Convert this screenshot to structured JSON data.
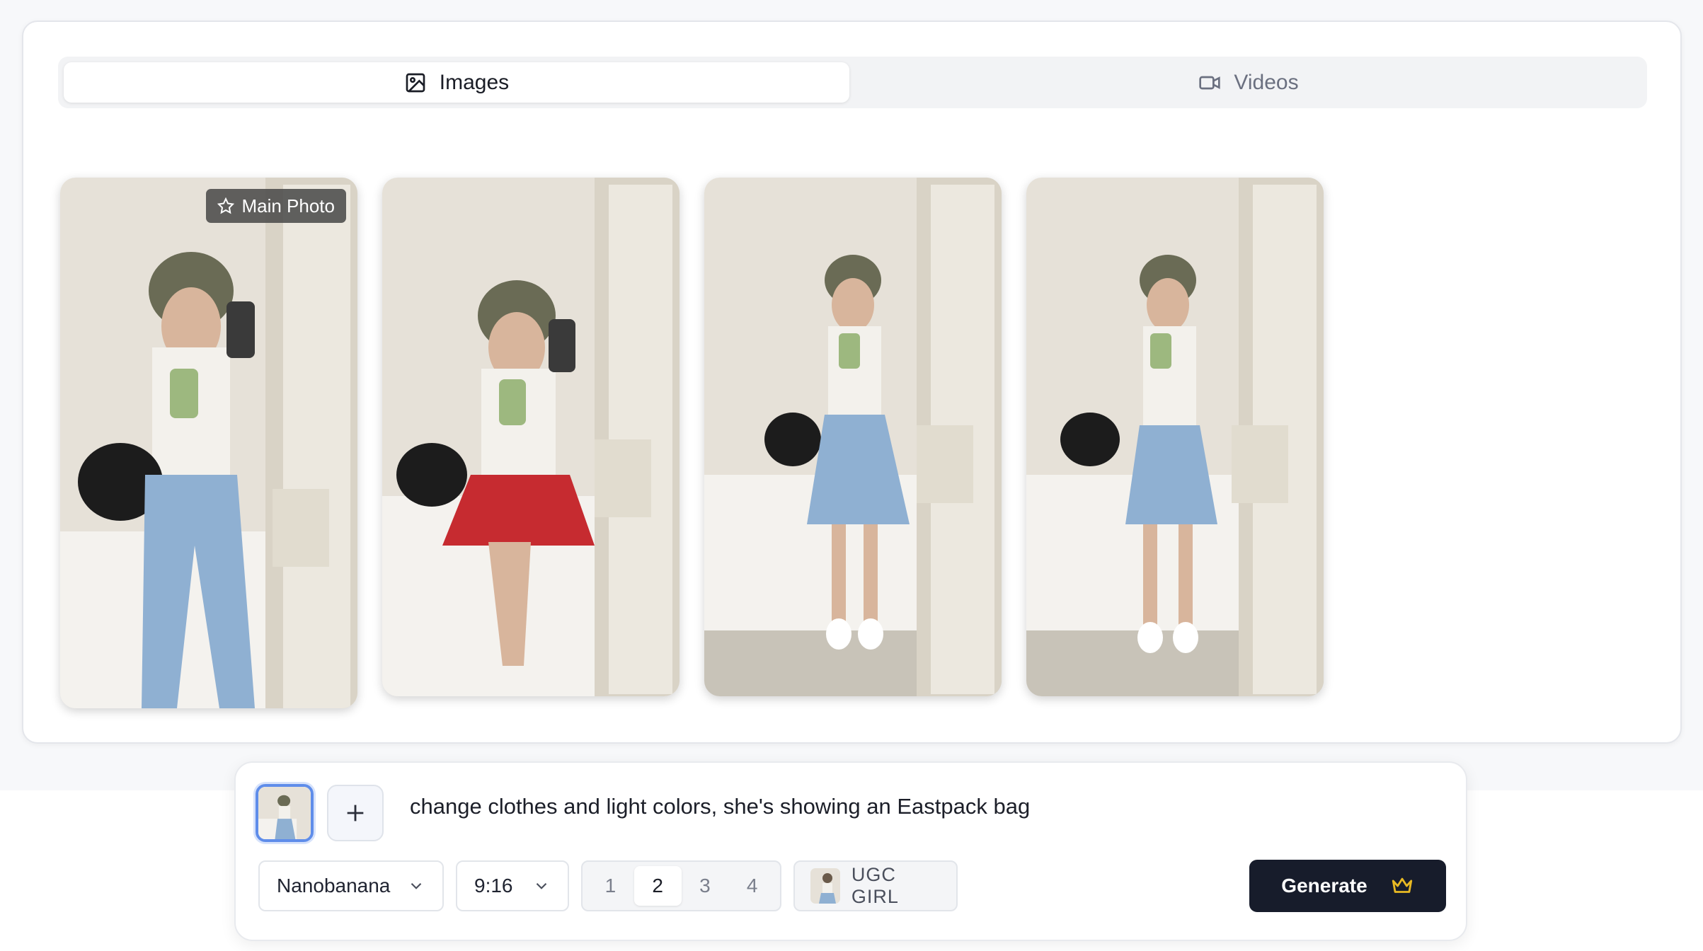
{
  "tabs": [
    {
      "label": "Images",
      "icon": "image-icon",
      "active": true
    },
    {
      "label": "Videos",
      "icon": "video-camera-icon",
      "active": false
    }
  ],
  "gallery": {
    "badge_label": "Main Photo",
    "photos": [
      {
        "outfit": "jeans",
        "main": true
      },
      {
        "outfit": "red-skirt",
        "main": false
      },
      {
        "outfit": "denim-skirt",
        "main": false
      },
      {
        "outfit": "denim-skirt",
        "main": false
      }
    ]
  },
  "composer": {
    "prompt": "change clothes and light colors, she's showing an Eastpack bag",
    "model": "Nanobanana",
    "aspect_ratio": "9:16",
    "counts": [
      "1",
      "2",
      "3",
      "4"
    ],
    "selected_count": "2",
    "avatar_label": "UGC GIRL",
    "generate_label": "Generate"
  },
  "colors": {
    "accent_blue": "#5f8dea",
    "generate_bg": "#171c2b",
    "crown": "#e8b923"
  }
}
